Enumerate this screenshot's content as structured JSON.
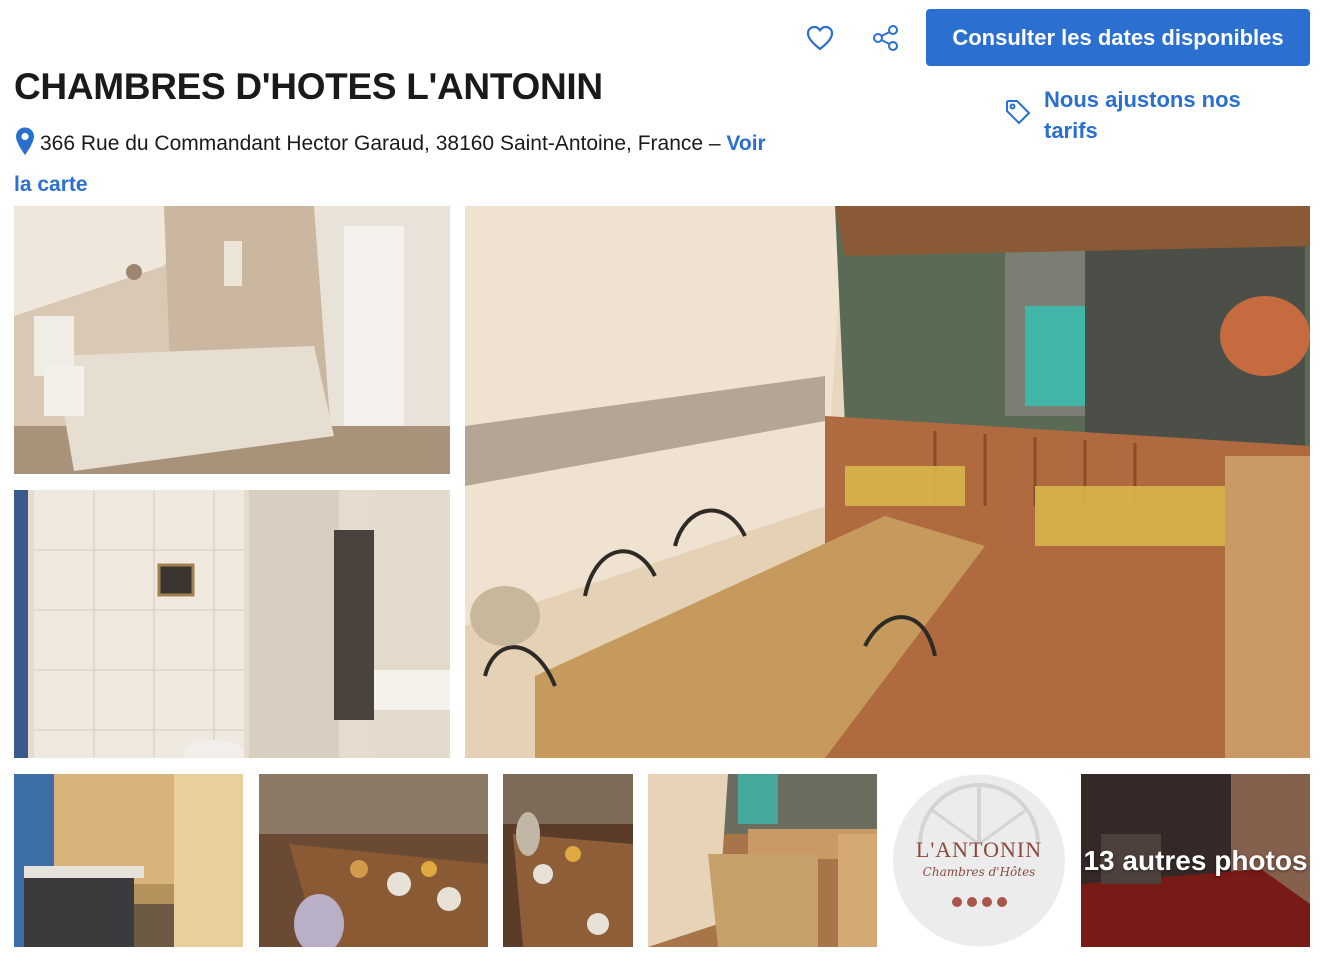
{
  "header": {
    "cta_label": "Consulter les dates disponibles",
    "favorite_icon": "heart-icon",
    "share_icon": "share-icon"
  },
  "property": {
    "name": "CHAMBRES D'HOTES L'ANTONIN",
    "address_line": "366 Rue du Commandant Hector Garaud, 38160 Saint-Antoine, France –",
    "map_link": "Voir la carte",
    "price_match": "Nous ajustons nos tarifs"
  },
  "gallery": {
    "logo_title": "L'ANTONIN",
    "logo_subtitle": "Chambres d'Hôtes",
    "more_photos": "13 autres photos"
  },
  "colors": {
    "accent": "#2b6fd0",
    "text": "#1a1a1a"
  }
}
